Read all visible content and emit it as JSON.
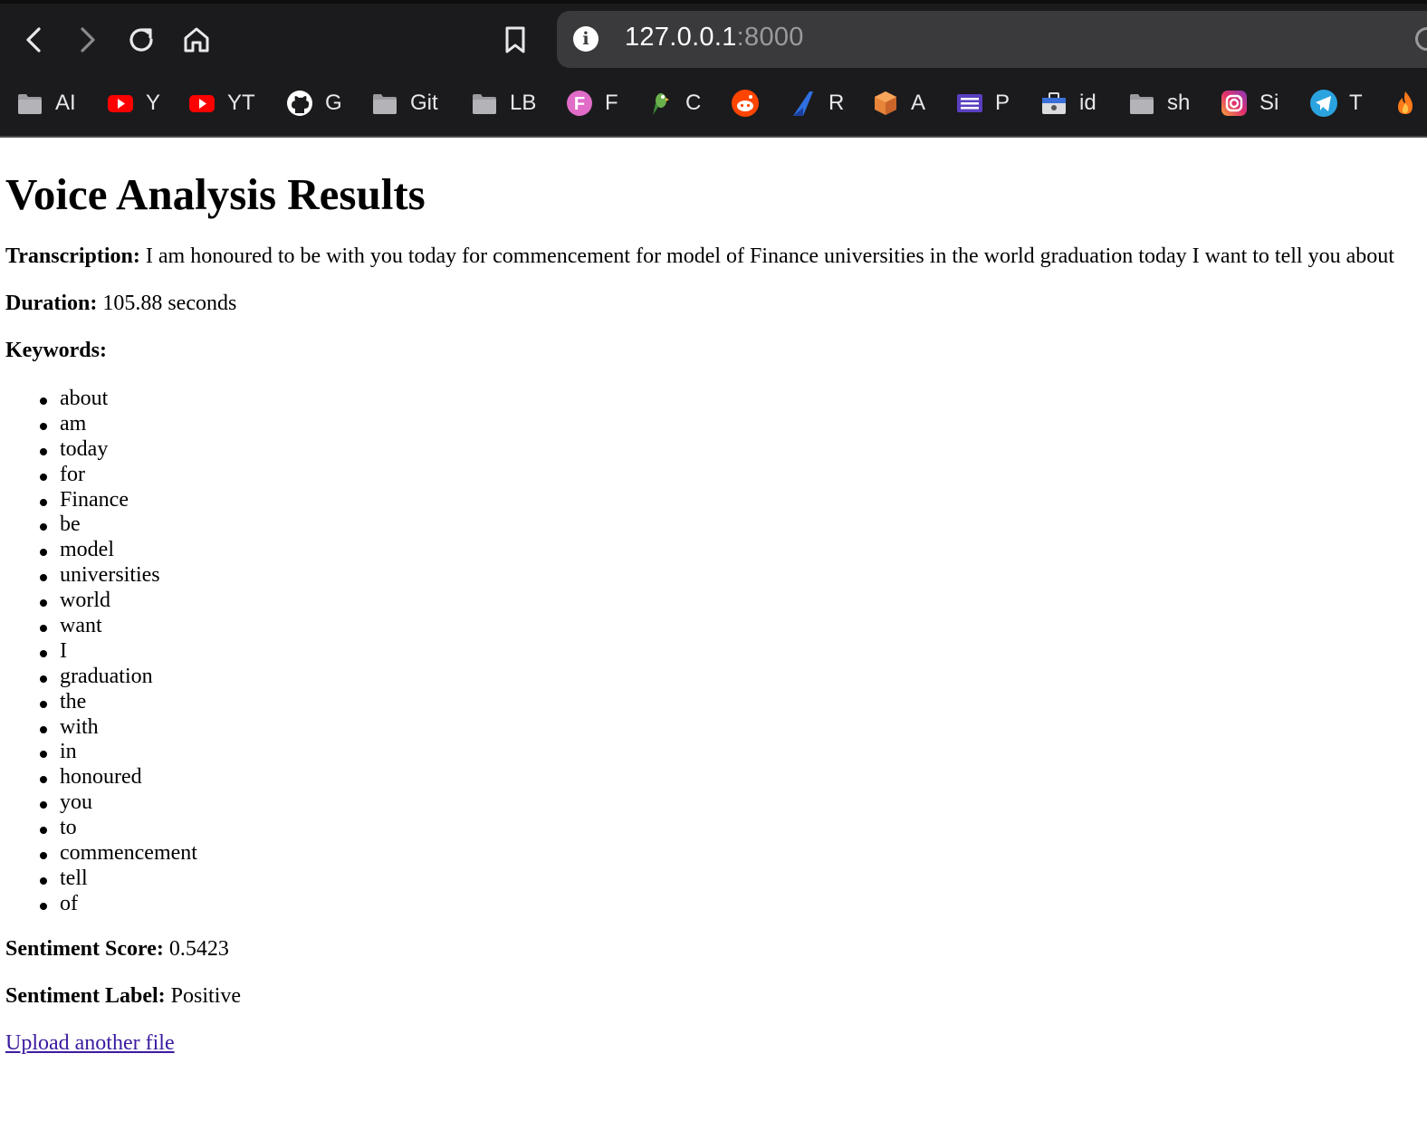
{
  "browser": {
    "url_host": "127.0.0.1",
    "url_port": ":8000",
    "bookmarks": [
      {
        "icon": "folder-icon",
        "label": "AI"
      },
      {
        "icon": "youtube-icon",
        "label": "Y"
      },
      {
        "icon": "youtube-icon",
        "label": "YT"
      },
      {
        "icon": "github-icon",
        "label": "G"
      },
      {
        "icon": "folder-icon",
        "label": "Git"
      },
      {
        "icon": "folder-icon",
        "label": "LB"
      },
      {
        "icon": "f-circle-icon",
        "label": "F"
      },
      {
        "icon": "parrot-icon",
        "label": "C"
      },
      {
        "icon": "reddit-icon",
        "label": ""
      },
      {
        "icon": "blue-slash-icon",
        "label": "R"
      },
      {
        "icon": "orange-box-icon",
        "label": "A"
      },
      {
        "icon": "purple-list-icon",
        "label": "P"
      },
      {
        "icon": "briefcase-icon",
        "label": "id"
      },
      {
        "icon": "folder-icon",
        "label": "sh"
      },
      {
        "icon": "instagram-icon",
        "label": "Si"
      },
      {
        "icon": "telegram-icon",
        "label": "T"
      },
      {
        "icon": "flame-icon",
        "label": ""
      }
    ]
  },
  "page": {
    "title": "Voice Analysis Results",
    "transcription_label": "Transcription:",
    "transcription": "I am honoured to be with you today for commencement for model of Finance universities in the world graduation today I want to tell you about",
    "duration_label": "Duration:",
    "duration": "105.88 seconds",
    "keywords_label": "Keywords:",
    "keywords": [
      "about",
      "am",
      "today",
      "for",
      "Finance",
      "be",
      "model",
      "universities",
      "world",
      "want",
      "I",
      "graduation",
      "the",
      "with",
      "in",
      "honoured",
      "you",
      "to",
      "commencement",
      "tell",
      "of"
    ],
    "sentiment_score_label": "Sentiment Score:",
    "sentiment_score": "0.5423",
    "sentiment_label_label": "Sentiment Label:",
    "sentiment_label": "Positive",
    "upload_link": "Upload another file"
  }
}
